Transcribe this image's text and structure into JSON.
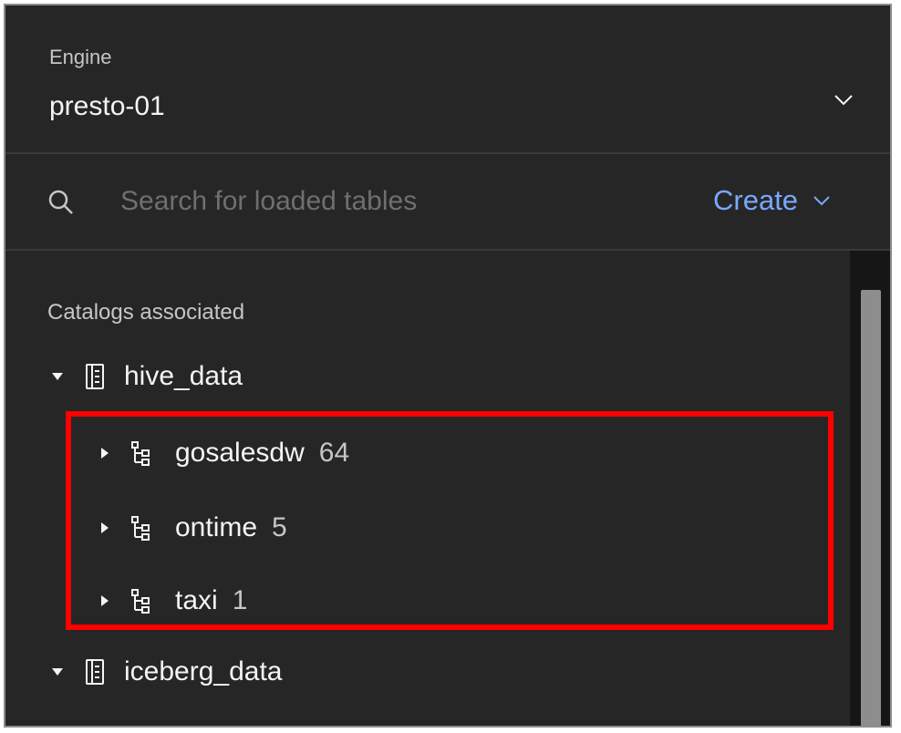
{
  "engine": {
    "label": "Engine",
    "value": "presto-01",
    "dropdown_icon": "chevron-down-icon"
  },
  "search": {
    "placeholder": "Search for loaded tables",
    "value": "",
    "icon": "search-icon"
  },
  "create": {
    "label": "Create",
    "icon": "chevron-down-icon"
  },
  "catalogs": {
    "title": "Catalogs associated",
    "items": [
      {
        "name": "hive_data",
        "expanded": true,
        "schemas": [
          {
            "name": "gosalesdw",
            "count": "64"
          },
          {
            "name": "ontime",
            "count": "5"
          },
          {
            "name": "taxi",
            "count": "1"
          }
        ]
      },
      {
        "name": "iceberg_data",
        "expanded": true,
        "schemas": []
      }
    ]
  },
  "colors": {
    "panel_bg": "#262626",
    "link": "#78a9ff",
    "highlight": "#ff0000"
  }
}
